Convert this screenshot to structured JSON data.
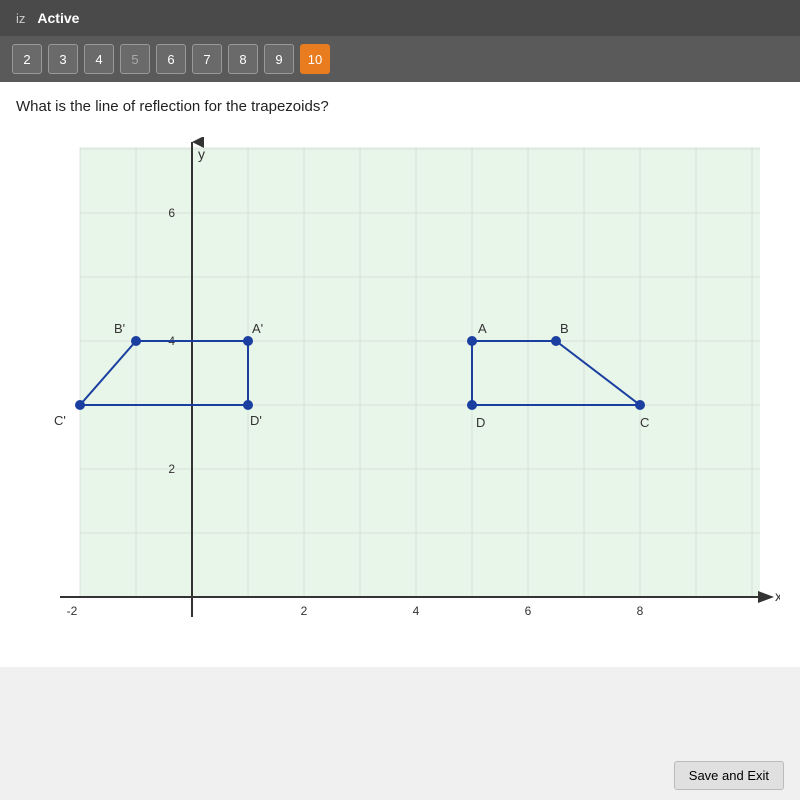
{
  "header": {
    "title": "iz",
    "status": "Active"
  },
  "nav": {
    "buttons": [
      {
        "label": "2",
        "active": false
      },
      {
        "label": "3",
        "active": false
      },
      {
        "label": "4",
        "active": false
      },
      {
        "label": "5",
        "active": false,
        "disabled": true
      },
      {
        "label": "6",
        "active": false
      },
      {
        "label": "7",
        "active": false
      },
      {
        "label": "8",
        "active": false
      },
      {
        "label": "9",
        "active": false
      },
      {
        "label": "10",
        "active": true
      }
    ]
  },
  "question": {
    "text": "What is the line of reflection for the trapezoids?"
  },
  "graph": {
    "x_axis_label": "x",
    "y_axis_label": "y",
    "x_min": -2,
    "x_max": 9,
    "y_min": 0,
    "y_max": 7,
    "points": {
      "A": {
        "x": 5,
        "y": 4,
        "label": "A"
      },
      "B": {
        "x": 7,
        "y": 4,
        "label": "B"
      },
      "C": {
        "x": 8,
        "y": 3,
        "label": "C"
      },
      "D": {
        "x": 5,
        "y": 3,
        "label": "D"
      },
      "Ap": {
        "x": 1,
        "y": 4,
        "label": "A'"
      },
      "Bp": {
        "x": -1,
        "y": 4,
        "label": "B'"
      },
      "Cp": {
        "x": -2,
        "y": 3,
        "label": "C'"
      },
      "Dp": {
        "x": 1,
        "y": 3,
        "label": "D'"
      }
    }
  },
  "bottom": {
    "save_exit_label": "Save and Exit"
  }
}
